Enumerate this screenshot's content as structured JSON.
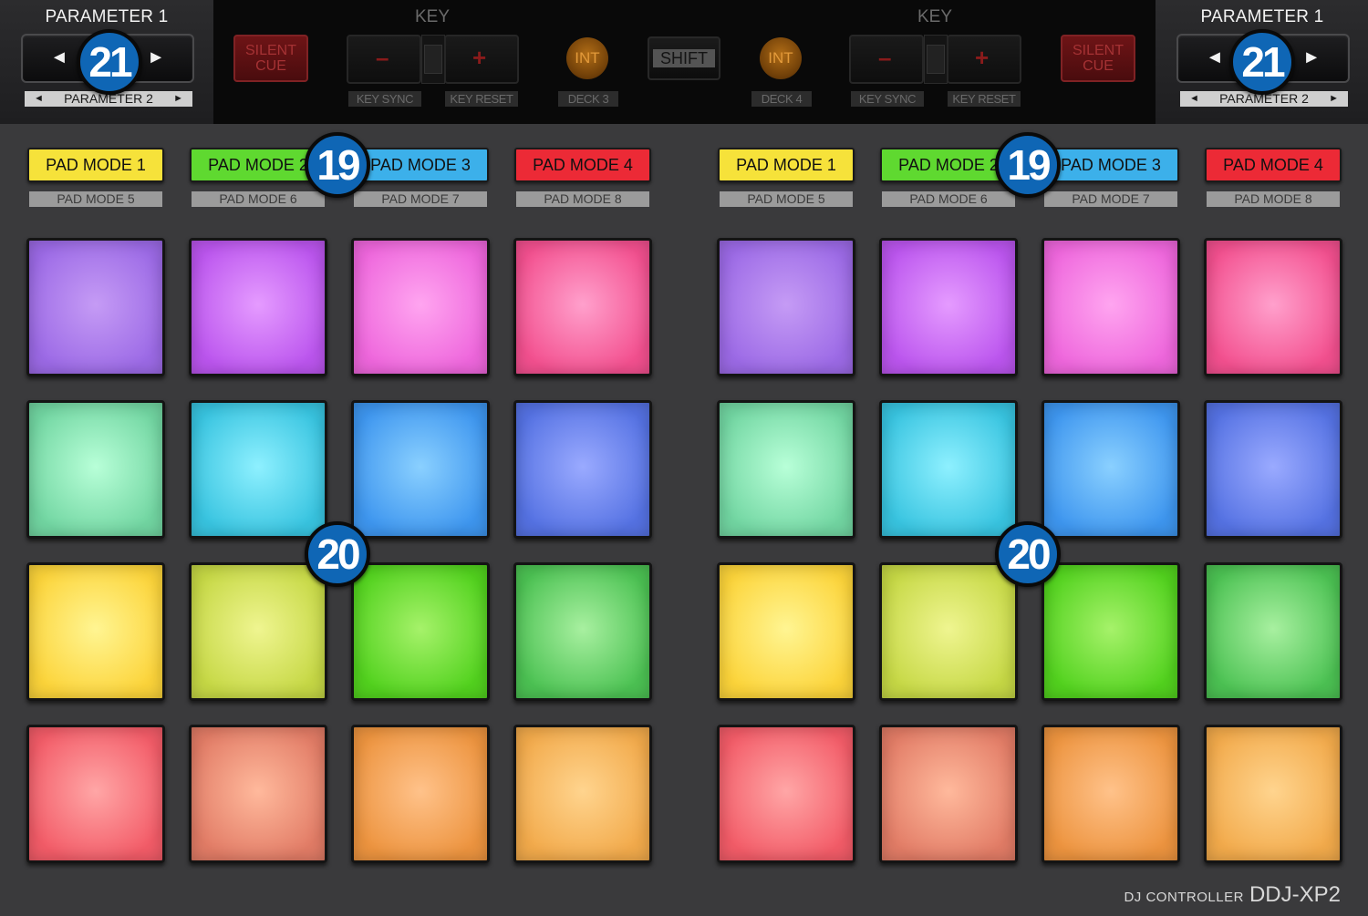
{
  "header": {
    "left_param": {
      "title": "PARAMETER 1",
      "sub": "PARAMETER 2",
      "arrow_left": "◄",
      "arrow_right": "►",
      "sub_left": "◄",
      "sub_right": "►"
    },
    "right_param": {
      "title": "PARAMETER 1",
      "sub": "PARAMETER 2",
      "arrow_left": "◄",
      "arrow_right": "►",
      "sub_left": "◄",
      "sub_right": "►"
    },
    "deck3": {
      "key_label": "KEY",
      "silent_cue": "SILENT\nCUE",
      "minus": "–",
      "plus": "+",
      "key_sync": "KEY SYNC",
      "key_reset": "KEY RESET",
      "int": "INT",
      "deck": "DECK 3"
    },
    "shift": "SHIFT",
    "deck4": {
      "key_label": "KEY",
      "silent_cue": "SILENT\nCUE",
      "minus": "–",
      "plus": "+",
      "key_sync": "KEY SYNC",
      "key_reset": "KEY RESET",
      "int": "INT",
      "deck": "DECK 4"
    }
  },
  "pad_modes": {
    "left": [
      {
        "label": "PAD MODE 1",
        "sub": "PAD MODE 5",
        "color": "#f6e23a"
      },
      {
        "label": "PAD MODE 2",
        "sub": "PAD MODE 6",
        "color": "#5fd930"
      },
      {
        "label": "PAD MODE 3",
        "sub": "PAD MODE 7",
        "color": "#3cb0ea"
      },
      {
        "label": "PAD MODE 4",
        "sub": "PAD MODE 8",
        "color": "#ec2a36"
      }
    ],
    "right": [
      {
        "label": "PAD MODE 1",
        "sub": "PAD MODE 5",
        "color": "#f6e23a"
      },
      {
        "label": "PAD MODE 2",
        "sub": "PAD MODE 6",
        "color": "#5fd930"
      },
      {
        "label": "PAD MODE 3",
        "sub": "PAD MODE 7",
        "color": "#3cb0ea"
      },
      {
        "label": "PAD MODE 4",
        "sub": "PAD MODE 8",
        "color": "#ec2a36"
      }
    ]
  },
  "pad_colors": [
    [
      [
        "#c59bf5",
        "#9c6ae6"
      ],
      [
        "#e59bff",
        "#bb55ee"
      ],
      [
        "#ffa5f0",
        "#ee66dc"
      ],
      [
        "#ffa0cc",
        "#f3508f"
      ]
    ],
    [
      [
        "#b8ffd8",
        "#72d6a2"
      ],
      [
        "#8ef0ff",
        "#38c4e0"
      ],
      [
        "#8ad0ff",
        "#3e96ef"
      ],
      [
        "#9aaaff",
        "#5572e3"
      ]
    ],
    [
      [
        "#fff592",
        "#fcd43a"
      ],
      [
        "#eff590",
        "#c6d845"
      ],
      [
        "#a6f26a",
        "#52d21e"
      ],
      [
        "#a8f0a0",
        "#4cc253"
      ]
    ],
    [
      [
        "#ffa6a6",
        "#f35c68"
      ],
      [
        "#ffb99c",
        "#e27c66"
      ],
      [
        "#ffc28a",
        "#ed943f"
      ],
      [
        "#ffd48e",
        "#f2aa4b"
      ]
    ]
  ],
  "callouts": {
    "param_left": "21",
    "param_right": "21",
    "mode_left": "19",
    "mode_right": "19",
    "pads_left": "20",
    "pads_right": "20"
  },
  "brand": {
    "small": "DJ CONTROLLER",
    "model": "DDJ-XP2"
  }
}
